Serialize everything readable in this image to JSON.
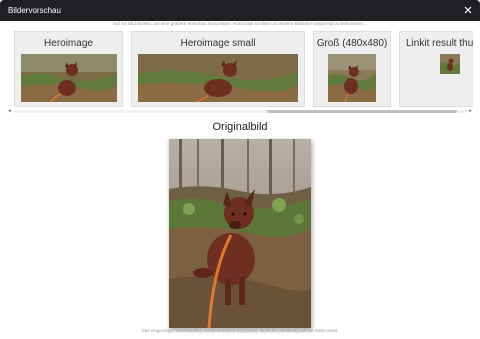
{
  "dialog": {
    "title": "Bildervorschau",
    "close_icon": "close-icon"
  },
  "hint_text": "Auf ein Bild klicken, um eine größere Vorschau anzuzeigen. Horizontal scrollen um weitere Bildsätze angezeigt zu bekommen...",
  "variants": [
    {
      "label": "Heroimage"
    },
    {
      "label": "Heroimage small"
    },
    {
      "label": "Groß (480x480)"
    },
    {
      "label": "Linkit result thum"
    }
  ],
  "original": {
    "title": "Originalbild"
  },
  "footer_text": "Das eingezeigte Vorschaubild, wurde eventuell angepasst, damit es vollständig auf die Seite passt.",
  "colors": {
    "titlebar": "#1f2023",
    "card_bg": "#eeeeee",
    "dog_fur": "#6e2f22",
    "leash": "#e0792a"
  }
}
